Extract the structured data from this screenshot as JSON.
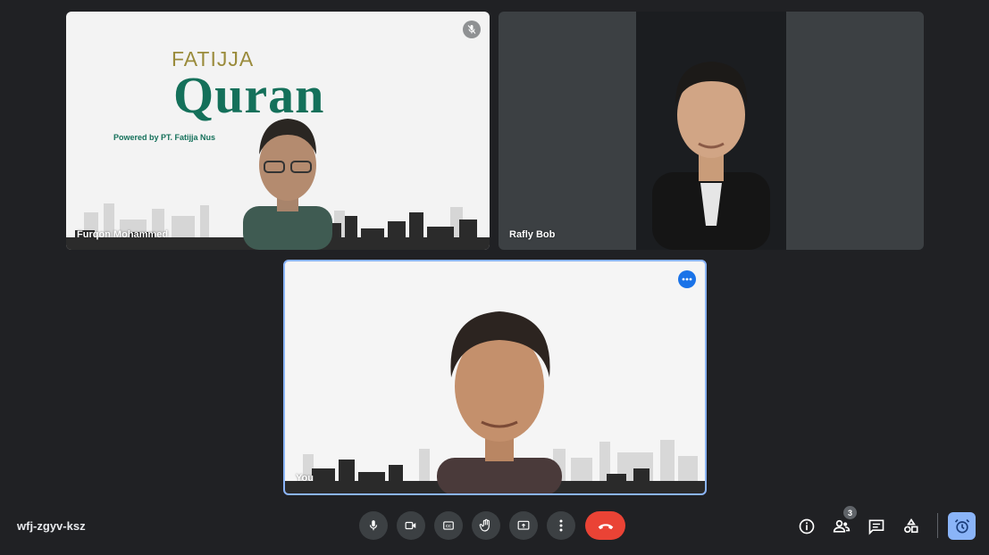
{
  "meeting": {
    "code": "wfj-zgyv-ksz"
  },
  "participants": [
    {
      "name": "Furqon Mohammed"
    },
    {
      "name": "Rafly Bob"
    },
    {
      "name": "You"
    }
  ],
  "background_brand": {
    "top_text": "FATIJJA",
    "main_text": "Quran",
    "sub_text": "Powered by PT. Fatijja Nus"
  },
  "people_count": "3",
  "icons": {
    "mute": "mic-off-icon",
    "more": "more-horiz-icon",
    "mic": "mic-icon",
    "camera": "videocam-icon",
    "captions": "closed-caption-icon",
    "hand": "raise-hand-icon",
    "present": "present-screen-icon",
    "more_options": "more-vert-icon",
    "end_call": "call-end-icon",
    "info": "info-icon",
    "people": "people-icon",
    "chat": "chat-icon",
    "activities": "shapes-icon",
    "host": "alarm-icon"
  },
  "colors": {
    "background": "#202124",
    "control": "#3c4043",
    "end_call": "#ea4335",
    "accent": "#8ab4f8",
    "brand_green": "#14705a",
    "brand_gold": "#9a8b3b"
  }
}
